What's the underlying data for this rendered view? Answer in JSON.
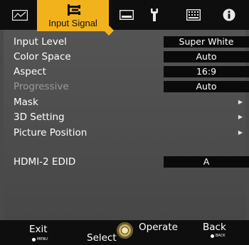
{
  "tabs": [
    {
      "name": "picture-adjust",
      "icon": "picture-adjust-icon"
    },
    {
      "name": "input-signal",
      "icon": "input-signal-icon",
      "label": "Input Signal",
      "active": true
    },
    {
      "name": "installation",
      "icon": "installation-icon"
    },
    {
      "name": "display-setup",
      "icon": "display-setup-icon"
    },
    {
      "name": "function",
      "icon": "wrench-icon"
    },
    {
      "name": "information",
      "icon": "info-icon"
    }
  ],
  "menu": {
    "rows": [
      {
        "label": "Input Level",
        "value": "Super White",
        "enabled": true
      },
      {
        "label": "Color Space",
        "value": "Auto",
        "enabled": true
      },
      {
        "label": "Aspect",
        "value": "16:9",
        "enabled": true
      },
      {
        "label": "Progressive",
        "value": "Auto",
        "enabled": false
      },
      {
        "label": "Mask",
        "submenu": true,
        "enabled": true
      },
      {
        "label": "3D Setting",
        "submenu": true,
        "enabled": true
      },
      {
        "label": "Picture Position",
        "submenu": true,
        "enabled": true
      },
      {
        "label": "HDMI-2 EDID",
        "value": "A",
        "enabled": true
      }
    ]
  },
  "footer": {
    "exit": "Exit",
    "exit_key": "MENU",
    "select": "Select",
    "operate": "Operate",
    "back": "Back",
    "back_key": "BACK"
  },
  "colors": {
    "accent": "#f2b21c",
    "panel": "#4f4f4f",
    "bar": "#0e0e0e",
    "value_box": "#0a0a0a",
    "disabled_text": "#9a9a9a"
  }
}
